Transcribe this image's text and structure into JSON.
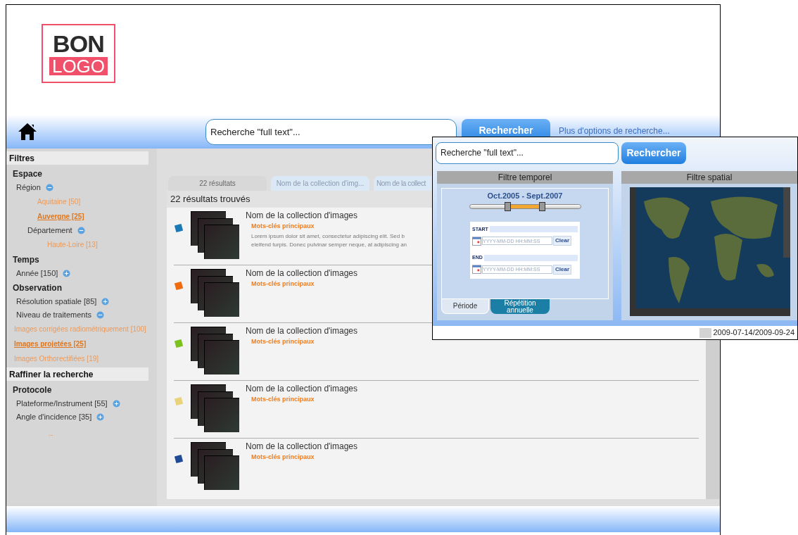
{
  "logo": {
    "top": "BON",
    "bottom": "LOGO"
  },
  "header": {
    "search": {
      "placeholder": "Recherche \"full text\"..."
    },
    "search_button": "Rechercher",
    "more_link": "Plus d'options de recherche..."
  },
  "sidebar": [
    {
      "kind": "section",
      "label": "Filtres"
    },
    {
      "kind": "group",
      "label": "Espace"
    },
    {
      "kind": "facet",
      "label": "Région",
      "expanded": true,
      "children": [
        {
          "kind": "value",
          "label": "Aquitaine [50]",
          "selected": false
        },
        {
          "kind": "value",
          "label": "Auvergne [25]",
          "selected": true
        },
        {
          "kind": "facet",
          "label": "Département",
          "expanded": true,
          "children": [
            {
              "kind": "value",
              "label": "Haute-Loire [13]",
              "selected": false
            }
          ]
        }
      ]
    },
    {
      "kind": "group",
      "label": "Temps"
    },
    {
      "kind": "facet",
      "label": "Année [150]",
      "expanded": false
    },
    {
      "kind": "group",
      "label": "Observation"
    },
    {
      "kind": "facet",
      "label": "Résolution spatiale [85]",
      "expanded": false
    },
    {
      "kind": "facet",
      "label": "Niveau de traitements",
      "expanded": true
    },
    {
      "kind": "value",
      "label": "Images corrigées radiométriquement [100]",
      "selected": false
    },
    {
      "kind": "value",
      "label": "Images projetées [25]",
      "selected": true
    },
    {
      "kind": "value",
      "label": "Images Orthorectifiées [19]",
      "selected": false
    },
    {
      "kind": "section",
      "label": "Raffiner la recherche"
    },
    {
      "kind": "group",
      "label": "Protocole"
    },
    {
      "kind": "facet",
      "label": "Plateforme/Instrument [55]",
      "expanded": false
    },
    {
      "kind": "facet",
      "label": "Angle d'incidence [35]",
      "expanded": false
    },
    {
      "kind": "more",
      "label": "..."
    }
  ],
  "tabs": [
    {
      "label": "22 résultats",
      "selected": true
    },
    {
      "label": "Nom de la collection d'img...",
      "selected": false
    },
    {
      "label": "Nom de la collect",
      "selected": false
    }
  ],
  "results": {
    "summary": "22 résultats trouvés",
    "rows": [
      {
        "color": "#1a78b4",
        "title": "Nom de la collection d'images",
        "keywords": "Mots-clés principaux",
        "description_lines": [
          "Lorem ipsum dolor sit amet, consectetur adipiscing elit. Sed b",
          "eleifend turpis. Donec pulvinar semper neque, at adipiscing an"
        ]
      },
      {
        "color": "#f06a0f",
        "title": "Nom de la collection d'images",
        "keywords": "Mots-clés principaux"
      },
      {
        "color": "#7cc21e",
        "title": "Nom de la collection d'images",
        "keywords": "Mots-clés principaux"
      },
      {
        "color": "#ead27a",
        "title": "Nom de la collection d'images",
        "keywords": "Mots-clés principaux"
      },
      {
        "color": "#1f4a96",
        "title": "Nom de la collection d'images",
        "keywords": "Mots-clés principaux"
      }
    ]
  },
  "popup": {
    "search": {
      "placeholder": "Recherche \"full text\"..."
    },
    "search_button": "Rechercher",
    "temporal": {
      "title": "Filtre temporel",
      "range_label": "Oct.2005 - Sept.2007",
      "slider": {
        "thumbs": [
          {
            "level": 0.34
          },
          {
            "level": 0.65
          }
        ]
      },
      "fields": [
        {
          "label": "START",
          "placeholder": "YYYY-MM-DD HH:MM:SS",
          "button": "Clear"
        },
        {
          "label": "END",
          "placeholder": "YYYY-MM-DD HH:MM:SS",
          "button": "Clear"
        }
      ],
      "tabs": [
        {
          "label": "Période",
          "selected": true
        },
        {
          "label": "Répétition annuelle",
          "selected": false
        }
      ]
    },
    "spatial": {
      "title": "Filtre spatial"
    },
    "status": "2009-07-14/2009-09-24"
  }
}
